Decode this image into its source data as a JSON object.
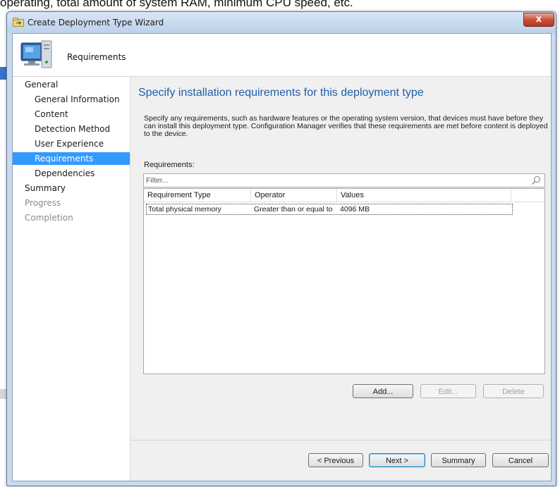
{
  "background": {
    "caption": "operating, total amount of system RAM, minimum CPU speed, etc."
  },
  "window": {
    "title": "Create Deployment Type Wizard",
    "close_glyph": "x"
  },
  "header": {
    "title": "Requirements",
    "icon": "computer-icon"
  },
  "sidebar": {
    "items": [
      {
        "label": "General",
        "level": 0,
        "state": "normal"
      },
      {
        "label": "General Information",
        "level": 1,
        "state": "normal"
      },
      {
        "label": "Content",
        "level": 1,
        "state": "normal"
      },
      {
        "label": "Detection Method",
        "level": 1,
        "state": "normal"
      },
      {
        "label": "User Experience",
        "level": 1,
        "state": "normal"
      },
      {
        "label": "Requirements",
        "level": 1,
        "state": "active"
      },
      {
        "label": "Dependencies",
        "level": 1,
        "state": "normal"
      },
      {
        "label": "Summary",
        "level": 0,
        "state": "normal"
      },
      {
        "label": "Progress",
        "level": 0,
        "state": "disabled"
      },
      {
        "label": "Completion",
        "level": 0,
        "state": "disabled"
      }
    ]
  },
  "main": {
    "heading": "Specify installation requirements for this deployment type",
    "description": "Specify any requirements, such as hardware features or the operating system version, that devices must have before they can install this deployment type. Configuration Manager verifies that these requirements are met before content is deployed to the device.",
    "requirements_label": "Requirements:",
    "filter_placeholder": "Filter...",
    "table": {
      "columns": [
        "Requirement Type",
        "Operator",
        "Values"
      ],
      "rows": [
        [
          "Total physical memory",
          "Greater than or equal to",
          "4096 MB"
        ]
      ]
    },
    "buttons": {
      "add": "Add...",
      "edit": "Edit...",
      "delete": "Delete"
    }
  },
  "footer": {
    "previous": "< Previous",
    "next": "Next >",
    "summary": "Summary",
    "cancel": "Cancel"
  },
  "colors": {
    "heading": "#1e5ea8",
    "active_nav": "#3399ff",
    "close_button": "#c74a33"
  }
}
